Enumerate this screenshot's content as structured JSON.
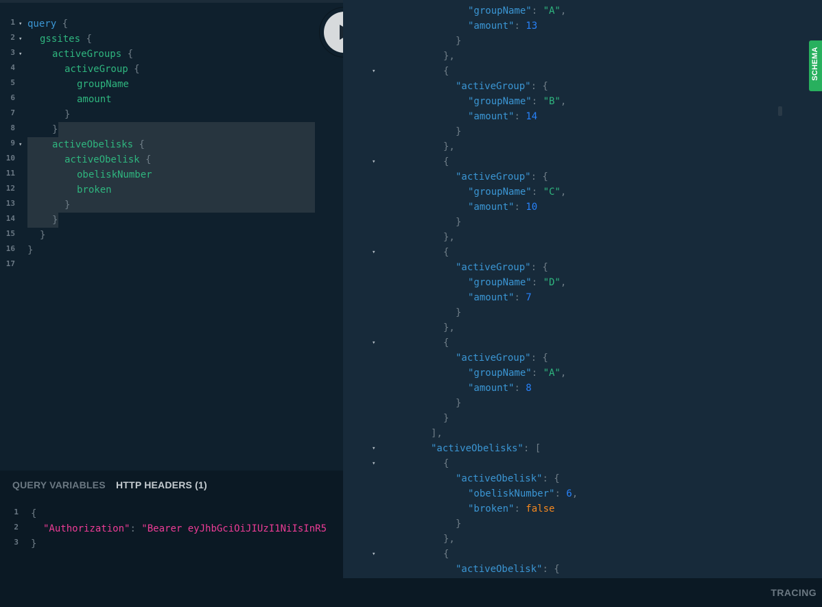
{
  "run_button": {
    "icon": "play-icon"
  },
  "query_editor": {
    "lines": [
      {
        "no": "1",
        "fold": "▾",
        "indent": 0,
        "tokens": [
          {
            "t": "query",
            "c": "kw"
          },
          {
            "t": " {",
            "c": "br"
          }
        ]
      },
      {
        "no": "2",
        "fold": "▾",
        "indent": 1,
        "tokens": [
          {
            "t": "gssites",
            "c": "fld"
          },
          {
            "t": " {",
            "c": "br"
          }
        ]
      },
      {
        "no": "3",
        "fold": "▾",
        "indent": 2,
        "tokens": [
          {
            "t": "activeGroups",
            "c": "fld"
          },
          {
            "t": " {",
            "c": "br"
          }
        ]
      },
      {
        "no": "4",
        "fold": "",
        "indent": 3,
        "tokens": [
          {
            "t": "activeGroup",
            "c": "fld"
          },
          {
            "t": " {",
            "c": "br"
          }
        ]
      },
      {
        "no": "5",
        "fold": "",
        "indent": 4,
        "tokens": [
          {
            "t": "groupName",
            "c": "fld"
          }
        ]
      },
      {
        "no": "6",
        "fold": "",
        "indent": 4,
        "tokens": [
          {
            "t": "amount",
            "c": "fld"
          }
        ]
      },
      {
        "no": "7",
        "fold": "",
        "indent": 3,
        "tokens": [
          {
            "t": "}",
            "c": "br"
          }
        ]
      },
      {
        "no": "8",
        "fold": "",
        "indent": 2,
        "tokens": [
          {
            "t": "}",
            "c": "br"
          }
        ]
      },
      {
        "no": "9",
        "fold": "▾",
        "indent": 2,
        "tokens": [
          {
            "t": "activeObelisks",
            "c": "fld"
          },
          {
            "t": " {",
            "c": "br"
          }
        ]
      },
      {
        "no": "10",
        "fold": "",
        "indent": 3,
        "tokens": [
          {
            "t": "activeObelisk",
            "c": "fld"
          },
          {
            "t": " {",
            "c": "br"
          }
        ]
      },
      {
        "no": "11",
        "fold": "",
        "indent": 4,
        "tokens": [
          {
            "t": "obeliskNumber",
            "c": "fld"
          }
        ]
      },
      {
        "no": "12",
        "fold": "",
        "indent": 4,
        "tokens": [
          {
            "t": "broken",
            "c": "fld"
          }
        ]
      },
      {
        "no": "13",
        "fold": "",
        "indent": 3,
        "tokens": [
          {
            "t": "}",
            "c": "br"
          }
        ]
      },
      {
        "no": "14",
        "fold": "",
        "indent": 2,
        "tokens": [
          {
            "t": "}",
            "c": "br"
          }
        ]
      },
      {
        "no": "15",
        "fold": "",
        "indent": 1,
        "tokens": [
          {
            "t": "}",
            "c": "br"
          }
        ]
      },
      {
        "no": "16",
        "fold": "",
        "indent": 0,
        "tokens": [
          {
            "t": "}",
            "c": "br"
          }
        ]
      },
      {
        "no": "17",
        "fold": "",
        "indent": 0,
        "tokens": []
      }
    ]
  },
  "variables_panel": {
    "tabs": {
      "query_variables": "QUERY VARIABLES",
      "http_headers": "HTTP HEADERS (1)"
    },
    "lines": [
      {
        "no": "1",
        "indent": 0,
        "tokens": [
          {
            "t": "{",
            "c": "br"
          }
        ]
      },
      {
        "no": "2",
        "indent": 1,
        "tokens": [
          {
            "t": "\"Authorization\"",
            "c": "pinkkey"
          },
          {
            "t": ": ",
            "c": "br"
          },
          {
            "t": "\"Bearer eyJhbGciOiJIUzI1NiIsInR5",
            "c": "pinkstr"
          }
        ]
      },
      {
        "no": "3",
        "indent": 0,
        "tokens": [
          {
            "t": "}",
            "c": "br"
          }
        ]
      }
    ]
  },
  "results": {
    "lines": [
      {
        "fold": "",
        "indent": 10,
        "tokens": [
          {
            "t": "\"groupName\"",
            "c": "key"
          },
          {
            "t": ": ",
            "c": "p"
          },
          {
            "t": "\"A\"",
            "c": "str"
          },
          {
            "t": ",",
            "c": "p"
          }
        ]
      },
      {
        "fold": "",
        "indent": 10,
        "tokens": [
          {
            "t": "\"amount\"",
            "c": "key"
          },
          {
            "t": ": ",
            "c": "p"
          },
          {
            "t": "13",
            "c": "num"
          }
        ]
      },
      {
        "fold": "",
        "indent": 9,
        "tokens": [
          {
            "t": "}",
            "c": "p"
          }
        ]
      },
      {
        "fold": "",
        "indent": 8,
        "tokens": [
          {
            "t": "},",
            "c": "p"
          }
        ]
      },
      {
        "fold": "▾",
        "indent": 8,
        "tokens": [
          {
            "t": "{",
            "c": "p"
          }
        ]
      },
      {
        "fold": "",
        "indent": 9,
        "tokens": [
          {
            "t": "\"activeGroup\"",
            "c": "key"
          },
          {
            "t": ": {",
            "c": "p"
          }
        ]
      },
      {
        "fold": "",
        "indent": 10,
        "tokens": [
          {
            "t": "\"groupName\"",
            "c": "key"
          },
          {
            "t": ": ",
            "c": "p"
          },
          {
            "t": "\"B\"",
            "c": "str"
          },
          {
            "t": ",",
            "c": "p"
          }
        ]
      },
      {
        "fold": "",
        "indent": 10,
        "tokens": [
          {
            "t": "\"amount\"",
            "c": "key"
          },
          {
            "t": ": ",
            "c": "p"
          },
          {
            "t": "14",
            "c": "num"
          }
        ]
      },
      {
        "fold": "",
        "indent": 9,
        "tokens": [
          {
            "t": "}",
            "c": "p"
          }
        ]
      },
      {
        "fold": "",
        "indent": 8,
        "tokens": [
          {
            "t": "},",
            "c": "p"
          }
        ]
      },
      {
        "fold": "▾",
        "indent": 8,
        "tokens": [
          {
            "t": "{",
            "c": "p"
          }
        ]
      },
      {
        "fold": "",
        "indent": 9,
        "tokens": [
          {
            "t": "\"activeGroup\"",
            "c": "key"
          },
          {
            "t": ": {",
            "c": "p"
          }
        ]
      },
      {
        "fold": "",
        "indent": 10,
        "tokens": [
          {
            "t": "\"groupName\"",
            "c": "key"
          },
          {
            "t": ": ",
            "c": "p"
          },
          {
            "t": "\"C\"",
            "c": "str"
          },
          {
            "t": ",",
            "c": "p"
          }
        ]
      },
      {
        "fold": "",
        "indent": 10,
        "tokens": [
          {
            "t": "\"amount\"",
            "c": "key"
          },
          {
            "t": ": ",
            "c": "p"
          },
          {
            "t": "10",
            "c": "num"
          }
        ]
      },
      {
        "fold": "",
        "indent": 9,
        "tokens": [
          {
            "t": "}",
            "c": "p"
          }
        ]
      },
      {
        "fold": "",
        "indent": 8,
        "tokens": [
          {
            "t": "},",
            "c": "p"
          }
        ]
      },
      {
        "fold": "▾",
        "indent": 8,
        "tokens": [
          {
            "t": "{",
            "c": "p"
          }
        ]
      },
      {
        "fold": "",
        "indent": 9,
        "tokens": [
          {
            "t": "\"activeGroup\"",
            "c": "key"
          },
          {
            "t": ": {",
            "c": "p"
          }
        ]
      },
      {
        "fold": "",
        "indent": 10,
        "tokens": [
          {
            "t": "\"groupName\"",
            "c": "key"
          },
          {
            "t": ": ",
            "c": "p"
          },
          {
            "t": "\"D\"",
            "c": "str"
          },
          {
            "t": ",",
            "c": "p"
          }
        ]
      },
      {
        "fold": "",
        "indent": 10,
        "tokens": [
          {
            "t": "\"amount\"",
            "c": "key"
          },
          {
            "t": ": ",
            "c": "p"
          },
          {
            "t": "7",
            "c": "num"
          }
        ]
      },
      {
        "fold": "",
        "indent": 9,
        "tokens": [
          {
            "t": "}",
            "c": "p"
          }
        ]
      },
      {
        "fold": "",
        "indent": 8,
        "tokens": [
          {
            "t": "},",
            "c": "p"
          }
        ]
      },
      {
        "fold": "▾",
        "indent": 8,
        "tokens": [
          {
            "t": "{",
            "c": "p"
          }
        ]
      },
      {
        "fold": "",
        "indent": 9,
        "tokens": [
          {
            "t": "\"activeGroup\"",
            "c": "key"
          },
          {
            "t": ": {",
            "c": "p"
          }
        ]
      },
      {
        "fold": "",
        "indent": 10,
        "tokens": [
          {
            "t": "\"groupName\"",
            "c": "key"
          },
          {
            "t": ": ",
            "c": "p"
          },
          {
            "t": "\"A\"",
            "c": "str"
          },
          {
            "t": ",",
            "c": "p"
          }
        ]
      },
      {
        "fold": "",
        "indent": 10,
        "tokens": [
          {
            "t": "\"amount\"",
            "c": "key"
          },
          {
            "t": ": ",
            "c": "p"
          },
          {
            "t": "8",
            "c": "num"
          }
        ]
      },
      {
        "fold": "",
        "indent": 9,
        "tokens": [
          {
            "t": "}",
            "c": "p"
          }
        ]
      },
      {
        "fold": "",
        "indent": 8,
        "tokens": [
          {
            "t": "}",
            "c": "p"
          }
        ]
      },
      {
        "fold": "",
        "indent": 7,
        "tokens": [
          {
            "t": "],",
            "c": "p"
          }
        ]
      },
      {
        "fold": "▾",
        "indent": 7,
        "tokens": [
          {
            "t": "\"activeObelisks\"",
            "c": "key"
          },
          {
            "t": ": [",
            "c": "p"
          }
        ]
      },
      {
        "fold": "▾",
        "indent": 8,
        "tokens": [
          {
            "t": "{",
            "c": "p"
          }
        ]
      },
      {
        "fold": "",
        "indent": 9,
        "tokens": [
          {
            "t": "\"activeObelisk\"",
            "c": "key"
          },
          {
            "t": ": {",
            "c": "p"
          }
        ]
      },
      {
        "fold": "",
        "indent": 10,
        "tokens": [
          {
            "t": "\"obeliskNumber\"",
            "c": "key"
          },
          {
            "t": ": ",
            "c": "p"
          },
          {
            "t": "6",
            "c": "num"
          },
          {
            "t": ",",
            "c": "p"
          }
        ]
      },
      {
        "fold": "",
        "indent": 10,
        "tokens": [
          {
            "t": "\"broken\"",
            "c": "key"
          },
          {
            "t": ": ",
            "c": "p"
          },
          {
            "t": "false",
            "c": "bool"
          }
        ]
      },
      {
        "fold": "",
        "indent": 9,
        "tokens": [
          {
            "t": "}",
            "c": "p"
          }
        ]
      },
      {
        "fold": "",
        "indent": 8,
        "tokens": [
          {
            "t": "},",
            "c": "p"
          }
        ]
      },
      {
        "fold": "▾",
        "indent": 8,
        "tokens": [
          {
            "t": "{",
            "c": "p"
          }
        ]
      },
      {
        "fold": "",
        "indent": 9,
        "tokens": [
          {
            "t": "\"activeObelisk\"",
            "c": "key"
          },
          {
            "t": ": {",
            "c": "p"
          }
        ]
      }
    ]
  },
  "side_tabs": {
    "schema": "SCHEMA"
  },
  "footer": {
    "tracing": "TRACING"
  }
}
